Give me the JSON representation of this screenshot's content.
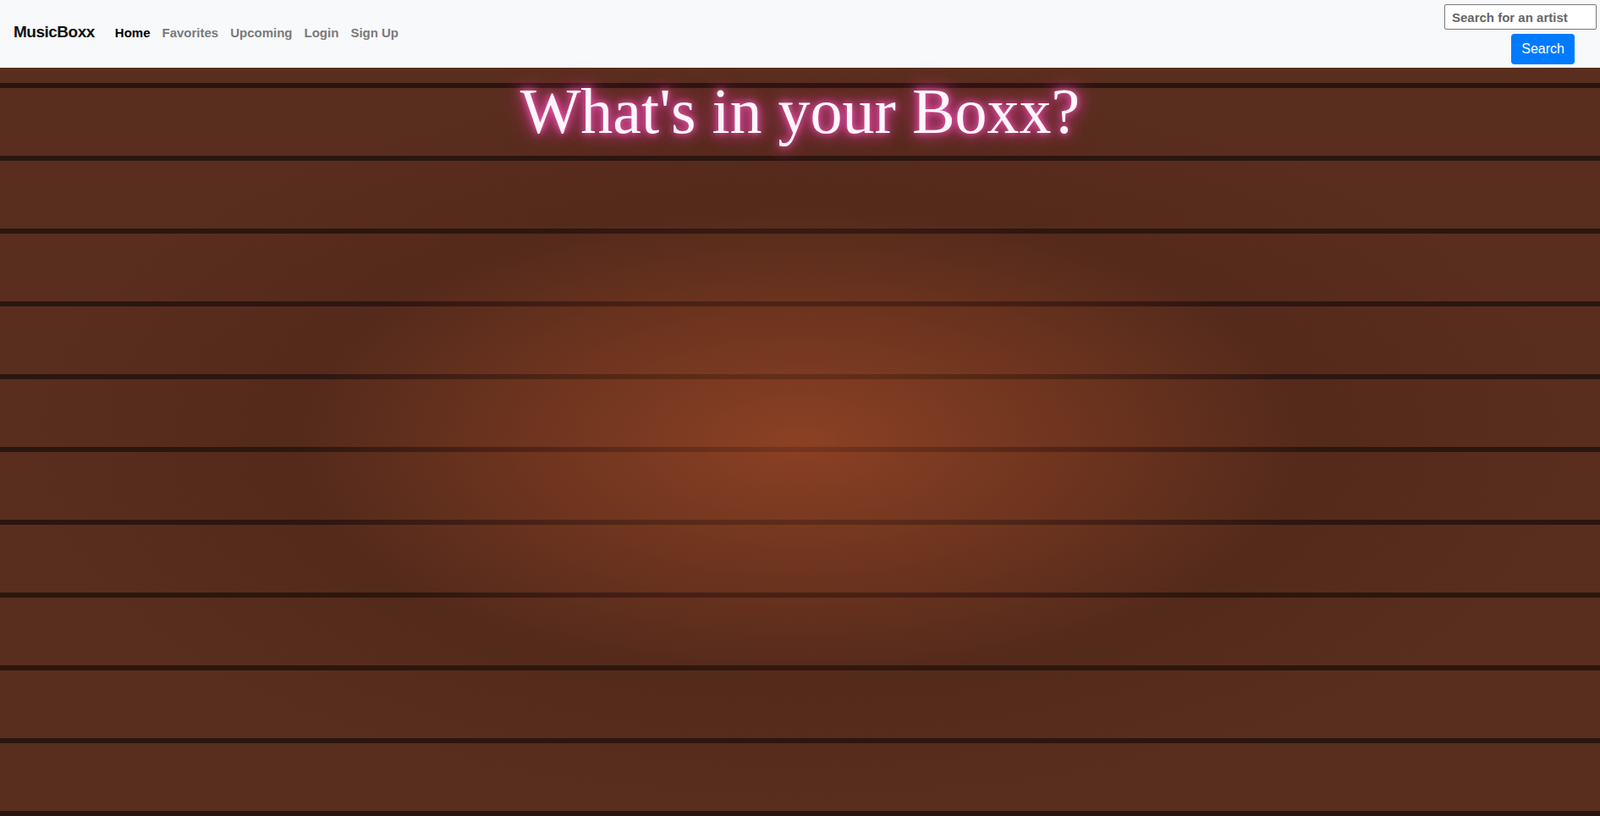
{
  "navbar": {
    "brand": "MusicBoxx",
    "links": [
      {
        "label": "Home",
        "selected": true
      },
      {
        "label": "Favorites",
        "selected": false
      },
      {
        "label": "Upcoming",
        "selected": false
      },
      {
        "label": "Login",
        "selected": false
      },
      {
        "label": "Sign Up",
        "selected": false
      }
    ]
  },
  "search": {
    "placeholder": "Search for an artist",
    "button": "Search"
  },
  "hero": {
    "title": "What's in your Boxx?"
  }
}
